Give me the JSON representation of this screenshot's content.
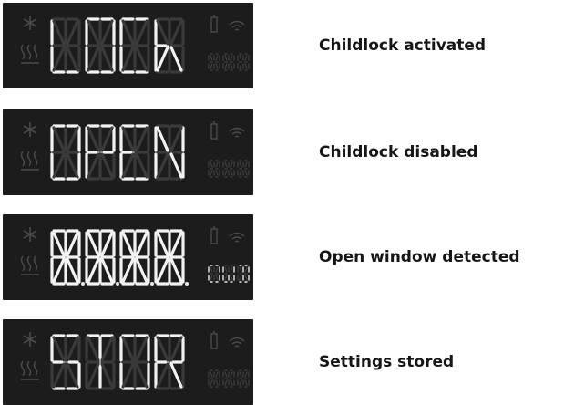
{
  "displays": [
    {
      "digits": [
        "L",
        "O",
        "C",
        "K"
      ],
      "mini": [
        "",
        "",
        ""
      ],
      "caption": "Childlock activated",
      "ghost": false
    },
    {
      "digits": [
        "O",
        "P",
        "E",
        "N"
      ],
      "mini": [
        "",
        "",
        ""
      ],
      "caption": "Childlock disabled",
      "ghost": false
    },
    {
      "digits": [
        "8",
        "8",
        "8",
        "8"
      ],
      "mini": [
        "O",
        "W",
        "D"
      ],
      "caption": "Open window detected",
      "ghost": true
    },
    {
      "digits": [
        "S",
        "T",
        "O",
        "R"
      ],
      "mini": [
        "",
        "",
        ""
      ],
      "caption": "Settings stored",
      "ghost": false
    }
  ],
  "icons": [
    "snowflake-icon",
    "heat-icon",
    "battery-icon",
    "wifi-icon"
  ],
  "colors": {
    "panel": "#1c1c1c",
    "segment_on": "#f2f2f2",
    "segment_off": "#3a3a3a",
    "caption": "#161616"
  }
}
